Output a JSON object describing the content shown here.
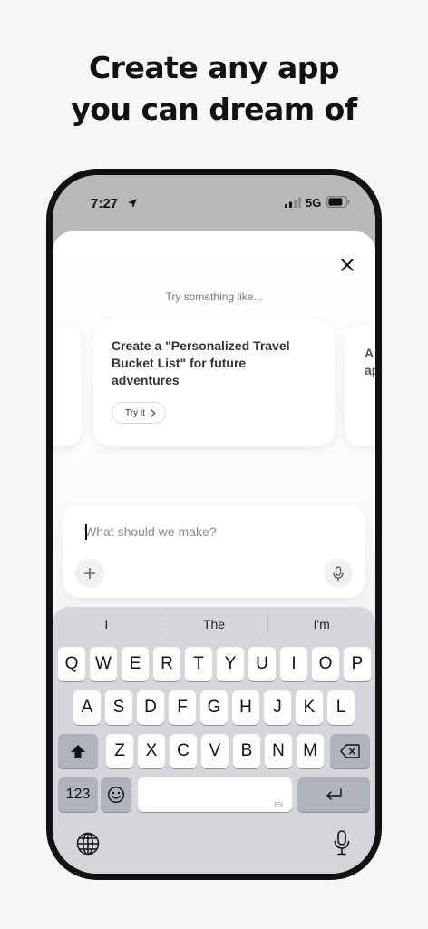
{
  "headline": {
    "line1": "Create any app",
    "line2": "you can dream of"
  },
  "status_bar": {
    "time": "7:27",
    "network": "5G"
  },
  "sheet": {
    "try_label": "Try something like...",
    "cards": [
      {
        "text": "Create a \"Personalized Travel Bucket List\" for future adventures",
        "button": "Try it"
      },
      {
        "text": "A ap"
      }
    ]
  },
  "composer": {
    "placeholder": "What should we make?",
    "value": ""
  },
  "keyboard": {
    "suggestions": [
      "I",
      "The",
      "I'm"
    ],
    "row1": [
      "Q",
      "W",
      "E",
      "R",
      "T",
      "Y",
      "U",
      "I",
      "O",
      "P"
    ],
    "row2": [
      "A",
      "S",
      "D",
      "F",
      "G",
      "H",
      "J",
      "K",
      "L"
    ],
    "row3": [
      "Z",
      "X",
      "C",
      "V",
      "B",
      "N",
      "M"
    ],
    "numbers_label": "123",
    "space_hint": "EN"
  },
  "icons": {
    "location": "location-arrow-icon",
    "signal": "signal-bars-icon",
    "battery": "battery-icon",
    "close": "close-icon",
    "chevron": "chevron-right-icon",
    "plus": "plus-icon",
    "mic": "microphone-icon",
    "shift": "shift-icon",
    "backspace": "backspace-icon",
    "emoji": "emoji-icon",
    "return": "return-icon",
    "globe": "globe-icon",
    "dictation": "dictation-mic-icon"
  }
}
